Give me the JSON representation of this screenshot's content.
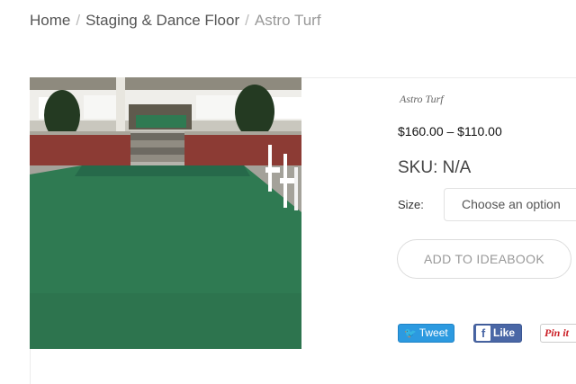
{
  "breadcrumb": {
    "home": "Home",
    "category": "Staging & Dance Floor",
    "current": "Astro Turf",
    "separator": "/"
  },
  "product": {
    "subtitle": "Astro Turf",
    "price": "$160.00 – $110.00",
    "sku": "SKU: N/A",
    "size_label": "Size:",
    "size_placeholder": "Choose an option",
    "image_alt": "Green astro turf runner leading to brick steps"
  },
  "actions": {
    "ideabook_label": "ADD TO IDEABOOK"
  },
  "social": {
    "tweet_label": "Tweet",
    "like_label": "Like",
    "facebook_icon_glyph": "f",
    "pin_label": "Pin it"
  },
  "colors": {
    "turf_green": "#2f7a52",
    "brick": "#8c3b34",
    "tweet_blue": "#2c9ae0",
    "facebook_blue": "#4a67a6",
    "pinterest_red": "#cb2027"
  }
}
